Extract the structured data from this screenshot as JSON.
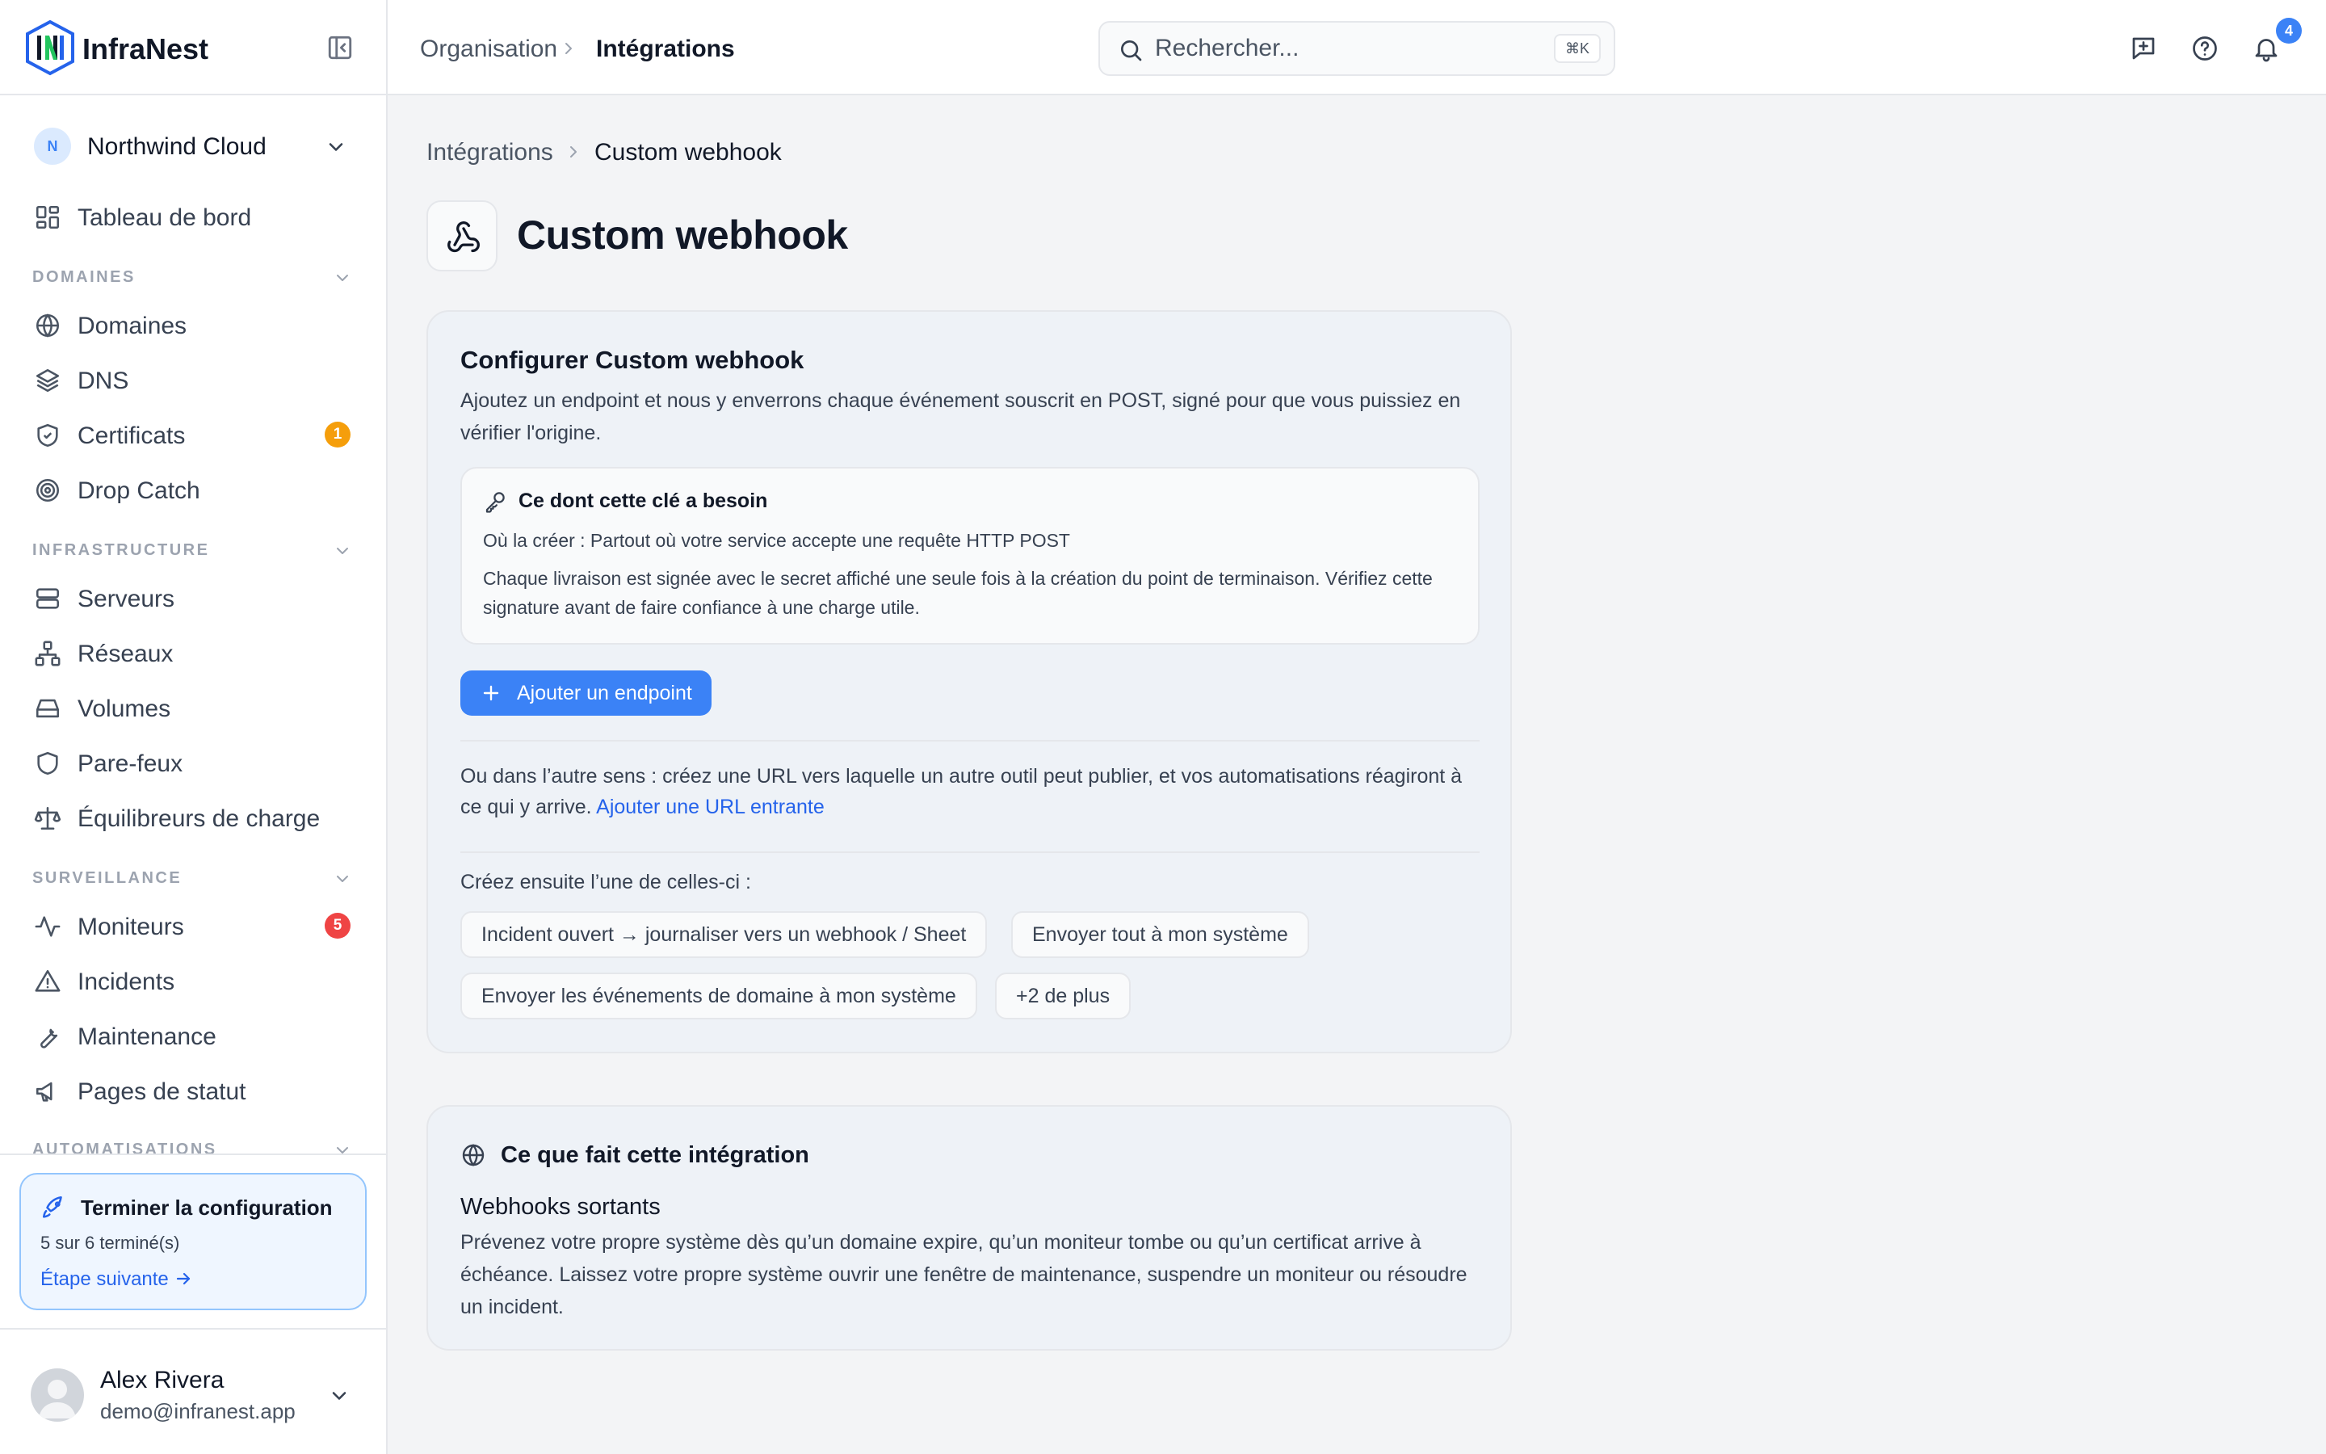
{
  "brand": {
    "name": "InfraNest"
  },
  "org": {
    "initial": "N",
    "name": "Northwind Cloud"
  },
  "sidebar": {
    "top_item": {
      "label": "Tableau de bord",
      "icon": "dashboard-icon"
    },
    "sections": [
      {
        "label": "DOMAINES"
      },
      {
        "label": "INFRASTRUCTURE"
      },
      {
        "label": "SURVEILLANCE"
      },
      {
        "label": "AUTOMATISATIONS"
      }
    ],
    "items": [
      {
        "label": "Domaines",
        "icon": "globe-icon"
      },
      {
        "label": "DNS",
        "icon": "layers-icon"
      },
      {
        "label": "Certificats",
        "icon": "shield-check-icon",
        "badge": "1",
        "badge_color": "#f59e0b"
      },
      {
        "label": "Drop Catch",
        "icon": "target-icon"
      },
      {
        "label": "Serveurs",
        "icon": "server-icon"
      },
      {
        "label": "Réseaux",
        "icon": "network-icon"
      },
      {
        "label": "Volumes",
        "icon": "hard-drive-icon"
      },
      {
        "label": "Pare-feux",
        "icon": "shield-icon"
      },
      {
        "label": "Équilibreurs de charge",
        "icon": "scale-icon"
      },
      {
        "label": "Moniteurs",
        "icon": "activity-icon",
        "badge": "5",
        "badge_color": "#ef4444"
      },
      {
        "label": "Incidents",
        "icon": "alert-triangle-icon"
      },
      {
        "label": "Maintenance",
        "icon": "wrench-icon"
      },
      {
        "label": "Pages de statut",
        "icon": "megaphone-icon"
      }
    ],
    "setup": {
      "title": "Terminer la configuration",
      "progress_text": "5 sur 6 terminé(s)",
      "next_label": "Étape suivante"
    },
    "user": {
      "name": "Alex Rivera",
      "email": "demo@infranest.app"
    }
  },
  "topbar": {
    "breadcrumb": [
      "Organisation",
      "Intégrations"
    ],
    "search": {
      "placeholder": "Rechercher...",
      "shortcut": "⌘K"
    },
    "notifications_count": "4"
  },
  "main": {
    "breadcrumb": [
      "Intégrations",
      "Custom webhook"
    ],
    "title": "Custom webhook",
    "configure": {
      "title": "Configurer Custom webhook",
      "description": "Ajoutez un endpoint et nous y enverrons chaque événement souscrit en POST, signé pour que vous puissiez en vérifier l'origine.",
      "needs": {
        "title": "Ce dont cette clé a besoin",
        "where": "Où la créer : Partout où votre service accepte une requête HTTP POST",
        "detail": "Chaque livraison est signée avec le secret affiché une seule fois à la création du point de terminaison. Vérifiez cette signature avant de faire confiance à une charge utile."
      },
      "add_button": "Ajouter un endpoint",
      "alt_text": "Ou dans l’autre sens : créez une URL vers laquelle un autre outil peut publier, et vos automatisations réagiront à ce qui y arrive.",
      "alt_link": "Ajouter une URL entrante",
      "then_label": "Créez ensuite l’une de celles-ci :",
      "chips": [
        "Incident ouvert → journaliser vers un webhook / Sheet",
        "Envoyer tout à mon système",
        "Envoyer les événements de domaine à mon système",
        "+2 de plus"
      ]
    },
    "about": {
      "title": "Ce que fait cette intégration",
      "subtitle": "Webhooks sortants",
      "description": "Prévenez votre propre système dès qu’un domaine expire, qu’un moniteur tombe ou qu’un certificat arrive à échéance. Laissez votre propre système ouvrir une fenêtre de maintenance, suspendre un moniteur ou résoudre un incident."
    }
  },
  "colors": {
    "accent": "#3b82f6",
    "link": "#2563eb",
    "brand_green": "#22c55e"
  }
}
